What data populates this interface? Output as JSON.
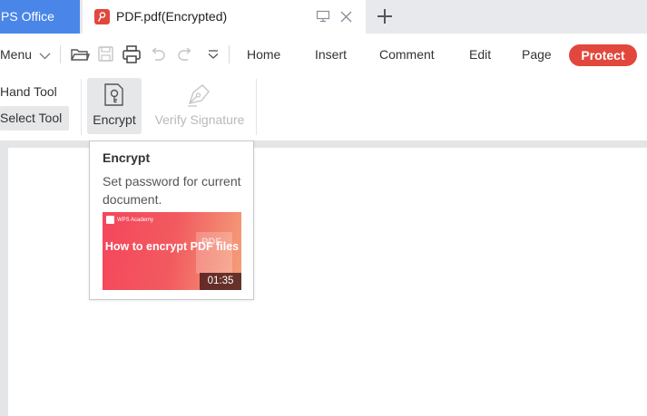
{
  "tabs": {
    "app_tab_label": "PS Office",
    "document_tab_title": "PDF.pdf(Encrypted)"
  },
  "ribbon": {
    "menu_label": "Menu",
    "tabs": [
      "Home",
      "Insert",
      "Comment",
      "Edit",
      "Page",
      "Protect"
    ],
    "active_tab": "Protect"
  },
  "toolbar": {
    "hand_tool": "Hand Tool",
    "select_tool": "Select Tool",
    "encrypt": "Encrypt",
    "verify_signature": "Verify Signature"
  },
  "tooltip": {
    "title": "Encrypt",
    "description": "Set password for current document.",
    "video": {
      "brand": "WPS Academy",
      "title": "How to encrypt PDF files",
      "duration": "01:35"
    }
  },
  "colors": {
    "accent_blue": "#4a86e8",
    "protect_red": "#e2473d",
    "tabbar_bg": "#e8e9ec",
    "workspace_bg": "#e4e5e7"
  }
}
